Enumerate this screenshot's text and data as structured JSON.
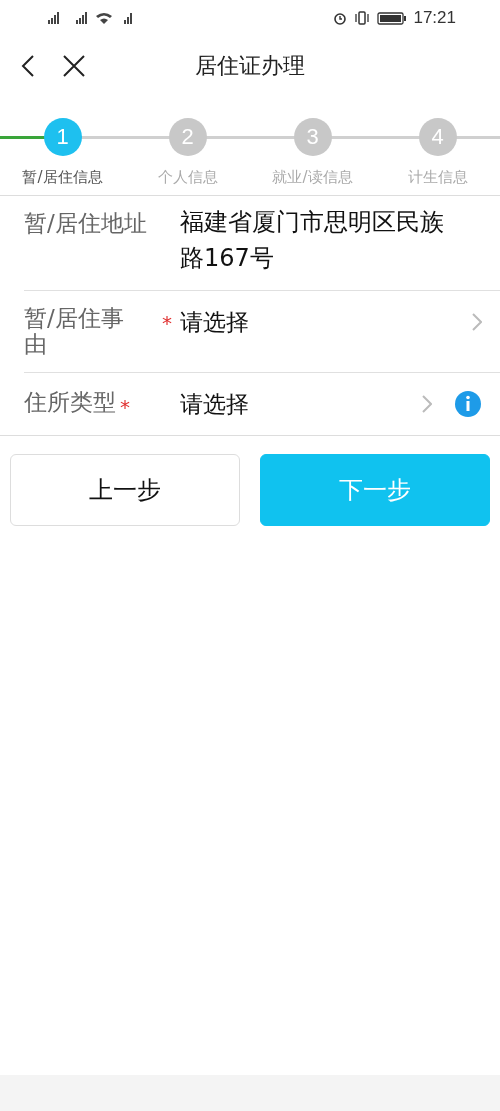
{
  "status_bar": {
    "time": "17:21"
  },
  "header": {
    "title": "居住证办理"
  },
  "steps": [
    {
      "number": "1",
      "label": "暂/居住信息",
      "selected": true
    },
    {
      "number": "2",
      "label": "个人信息",
      "selected": false
    },
    {
      "number": "3",
      "label": "就业/读信息",
      "selected": false
    },
    {
      "number": "4",
      "label": "计生信息",
      "selected": false
    }
  ],
  "form": [
    {
      "kind": "text",
      "label": "暂/居住地址",
      "value": "福建省厦门市思明区民族路167号"
    },
    {
      "kind": "select",
      "label": "暂/居住事由",
      "required_mark": "*",
      "value": "请选择"
    },
    {
      "kind": "select_info",
      "label": "住所类型",
      "required_mark": "*",
      "value": "请选择"
    }
  ],
  "buttons": [
    {
      "label": "上一步",
      "kind": "secondary"
    },
    {
      "label": "下一步",
      "kind": "primary"
    }
  ]
}
